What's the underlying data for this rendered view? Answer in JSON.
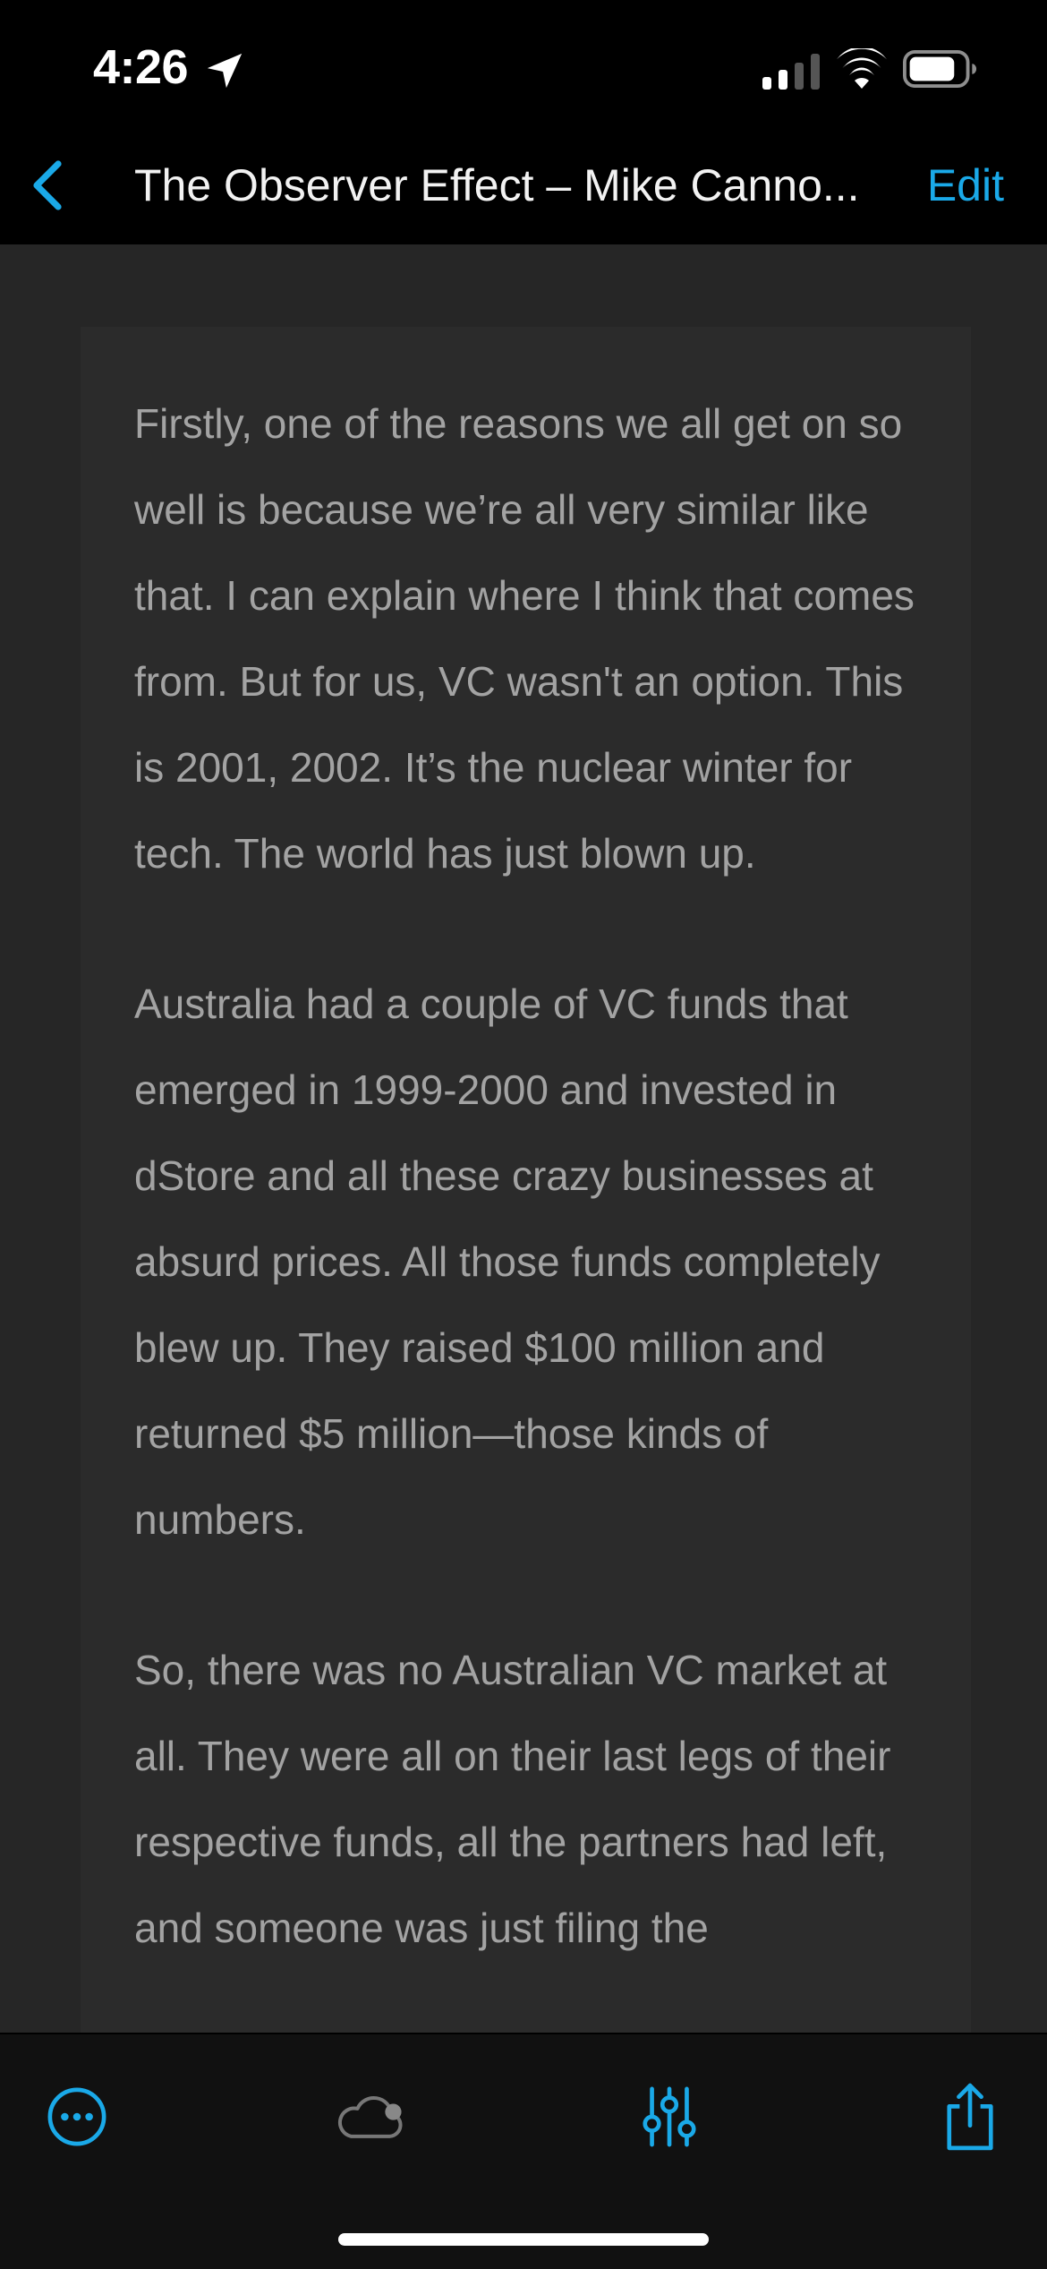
{
  "status_bar": {
    "time": "4:26",
    "icons": [
      "location-arrow-icon",
      "cellular-signal-icon",
      "wifi-icon",
      "battery-icon"
    ]
  },
  "nav": {
    "back_icon": "chevron-left-icon",
    "title": "The Observer Effect – Mike Canno...",
    "edit_label": "Edit"
  },
  "article": {
    "paragraphs": [
      "Firstly, one of the reasons we all get on so well is because we’re all very similar like that. I can explain where I think that comes from. But for us, VC wasn't an option. This is 2001, 2002. It’s the nuclear winter for tech. The world has just blown up.",
      "Australia had a couple of VC funds that emerged in 1999-2000 and invested in dStore and all these crazy businesses at absurd prices. All those funds completely blew up. They raised $100 million and returned $5 million—those kinds of numbers.",
      "So, there was no Australian VC market at all. They were all on their last legs of their respective funds, all the partners had left, and someone was just filing the"
    ]
  },
  "toolbar": {
    "items": [
      "more-icon",
      "cloud-icon",
      "adjustments-icon",
      "share-icon"
    ]
  },
  "colors": {
    "accent": "#1aa9e8",
    "text_body": "#a3a3a3",
    "background": "#262626",
    "card": "#2b2b2b",
    "bar": "#000000",
    "toolbar": "#111111"
  }
}
